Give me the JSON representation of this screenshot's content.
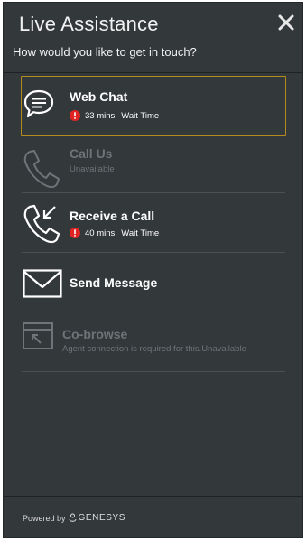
{
  "header": {
    "title": "Live Assistance",
    "subtitle": "How would you like to get in touch?",
    "close_icon": "close-icon"
  },
  "options": [
    {
      "label": "Web Chat",
      "wait": "33 mins",
      "wait_label": "Wait Time",
      "icon": "chat-bubble-icon",
      "state": "selected"
    },
    {
      "label": "Call Us",
      "status": "Unavailable",
      "icon": "phone-icon",
      "state": "disabled"
    },
    {
      "label": "Receive a Call",
      "wait": "40 mins",
      "wait_label": "Wait Time",
      "icon": "phone-incoming-icon",
      "state": "enabled"
    },
    {
      "label": "Send Message",
      "icon": "envelope-icon",
      "state": "enabled"
    },
    {
      "label": "Co-browse",
      "status": "Agent connection is required for this.Unavailable",
      "icon": "cobrowse-icon",
      "state": "disabled"
    }
  ],
  "footer": {
    "powered_by": "Powered by",
    "brand": "GENESYS"
  },
  "colors": {
    "panel_bg": "#33383b",
    "selected_border": "#b58a1e",
    "alert_red": "#e02424",
    "disabled_text": "#6e7477"
  }
}
